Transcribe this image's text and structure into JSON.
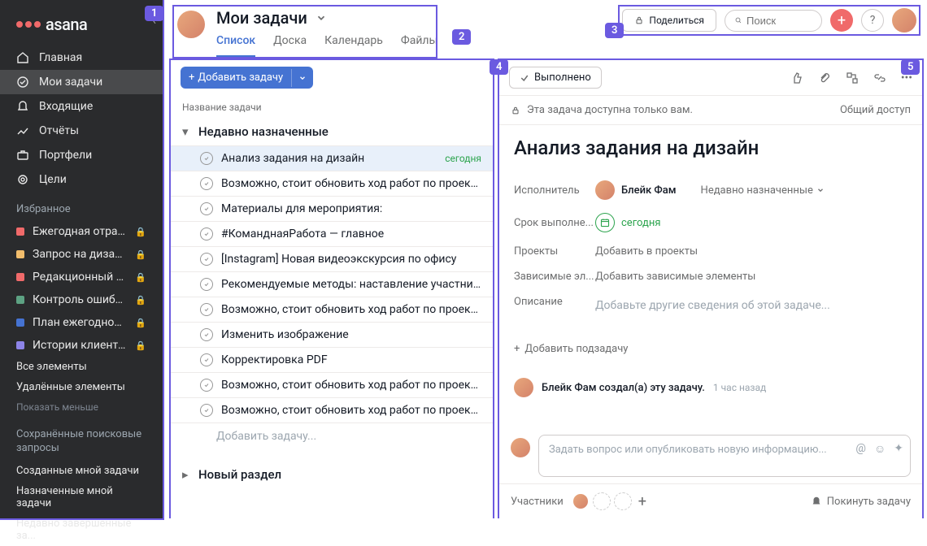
{
  "logo": "asana",
  "sidebar": {
    "nav": [
      {
        "label": "Главная"
      },
      {
        "label": "Мои задачи"
      },
      {
        "label": "Входящие"
      },
      {
        "label": "Отчёты"
      },
      {
        "label": "Портфели"
      },
      {
        "label": "Цели"
      }
    ],
    "favorites_title": "Избранное",
    "favorites": [
      {
        "label": "Ежегодная отрас...",
        "color": "#f06a6a"
      },
      {
        "label": "Запрос на дизайн...",
        "color": "#f1bd6c"
      },
      {
        "label": "Редакционный ка...",
        "color": "#f06a6a"
      },
      {
        "label": "Контроль ошибок",
        "color": "#5da283"
      },
      {
        "label": "План ежегодной ...",
        "color": "#4573d2"
      },
      {
        "label": "Истории клиенто...",
        "color": "#8d84e8"
      }
    ],
    "all_elements": "Все элементы",
    "deleted_elements": "Удалённые элементы",
    "show_less": "Показать меньше",
    "saved_queries_title": "Сохранённые поисковые запросы",
    "saved_queries": [
      "Созданные мной задачи",
      "Назначенные мной задачи",
      "Недавно завершённые за..."
    ]
  },
  "header": {
    "title": "Мои задачи",
    "tabs": [
      {
        "label": "Список",
        "active": true
      },
      {
        "label": "Доска"
      },
      {
        "label": "Календарь"
      },
      {
        "label": "Файлы"
      }
    ],
    "share": "Поделиться",
    "search_placeholder": "Поиск"
  },
  "list": {
    "add_task": "Добавить задачу",
    "column_header": "Название задачи",
    "section1": "Недавно назначенные",
    "tasks": [
      {
        "title": "Анализ задания на дизайн",
        "due": "сегодня",
        "selected": true
      },
      {
        "title": "Возможно, стоит обновить ход работ по проекту"
      },
      {
        "title": "Материалы для мероприятия:"
      },
      {
        "title": "#КоманднаяРабота — главное"
      },
      {
        "title": "[Instagram] Новая видеоэкскурсия по офису"
      },
      {
        "title": "Рекомендуемые методы: наставление участников гр"
      },
      {
        "title": "Возможно, стоит обновить ход работ по проекту"
      },
      {
        "title": "Изменить изображение"
      },
      {
        "title": "Корректировка PDF"
      },
      {
        "title": "Возможно, стоит обновить ход работ по проекту"
      },
      {
        "title": "Возможно, стоит обновить ход работ по проекту"
      }
    ],
    "add_placeholder": "Добавить задачу...",
    "section2": "Новый раздел"
  },
  "detail": {
    "done": "Выполнено",
    "privacy_text": "Эта задача доступна только вам.",
    "public_access": "Общий доступ",
    "title": "Анализ задания на дизайн",
    "fields": {
      "assignee_label": "Исполнитель",
      "assignee_value": "Блейк Фам",
      "assignee_section": "Недавно назначенные",
      "due_label": "Срок выполне...",
      "due_value": "сегодня",
      "projects_label": "Проекты",
      "projects_placeholder": "Добавить в проекты",
      "deps_label": "Зависимые эл...",
      "deps_placeholder": "Добавить зависимые элементы",
      "desc_label": "Описание",
      "desc_placeholder": "Добавьте другие сведения об этой задаче..."
    },
    "add_subtask": "Добавить подзадачу",
    "activity_text": "Блейк Фам создал(а) эту задачу.",
    "activity_time": "1 час назад",
    "comment_placeholder": "Задать вопрос или опубликовать новую информацию...",
    "collaborators_label": "Участники",
    "leave_task": "Покинуть задачу"
  },
  "badges": [
    "1",
    "2",
    "3",
    "4",
    "5"
  ]
}
